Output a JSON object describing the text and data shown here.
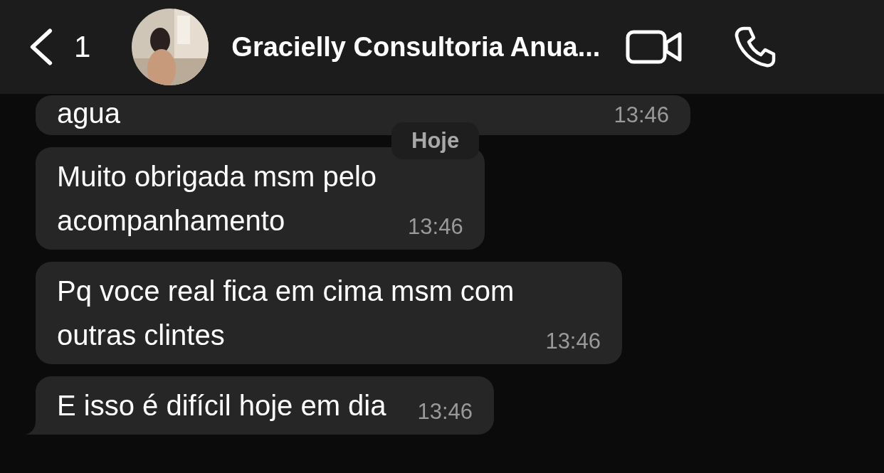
{
  "header": {
    "back_count": "1",
    "title": "Gracielly Consultoria Anua..."
  },
  "date_chip": "Hoje",
  "messages": [
    {
      "text": "agua",
      "time": "13:46",
      "tail": false
    },
    {
      "text": "Muito obrigada msm pelo\nacompanhamento",
      "time": "13:46",
      "tail": false
    },
    {
      "text": "Pq voce real fica em cima msm com\noutras clintes",
      "time": "13:46",
      "tail": false
    },
    {
      "text": "E isso é difícil hoje em dia",
      "time": "13:46",
      "tail": true
    }
  ]
}
